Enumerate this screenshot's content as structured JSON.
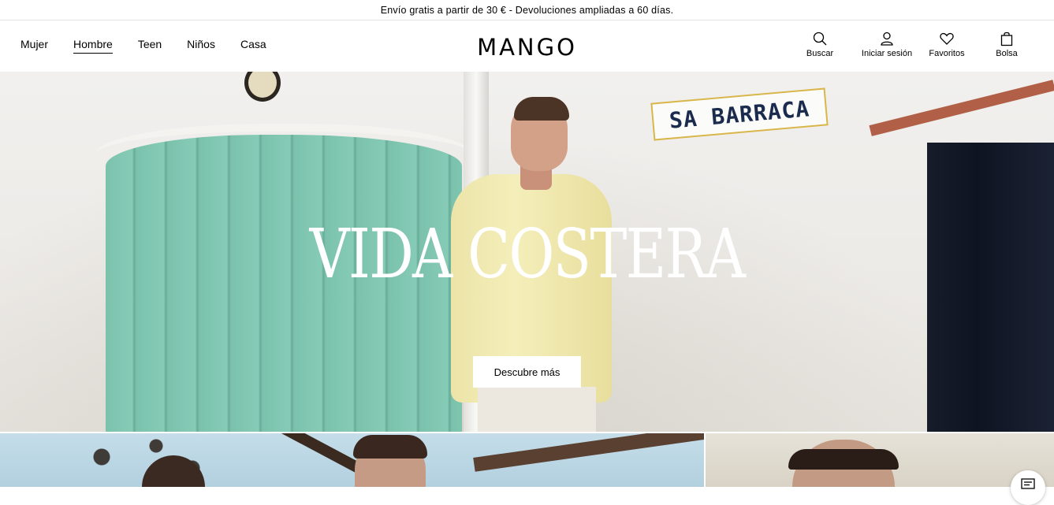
{
  "promo": {
    "text": "Envío gratis a partir de 30 € - Devoluciones ampliadas a 60 días."
  },
  "nav": {
    "items": [
      {
        "label": "Mujer"
      },
      {
        "label": "Hombre",
        "active": true
      },
      {
        "label": "Teen"
      },
      {
        "label": "Niños"
      },
      {
        "label": "Casa"
      }
    ]
  },
  "logo": {
    "text": "MANGO"
  },
  "actions": {
    "search": {
      "label": "Buscar",
      "icon": "search-icon"
    },
    "login": {
      "label": "Iniciar sesión",
      "icon": "user-icon"
    },
    "favorites": {
      "label": "Favoritos",
      "icon": "heart-icon"
    },
    "bag": {
      "label": "Bolsa",
      "icon": "bag-icon"
    }
  },
  "hero": {
    "title": "VIDA COSTERA",
    "cta": "Descubre más",
    "sign_text": "SA BARRACA"
  },
  "colors": {
    "accent": "#000000",
    "background": "#ffffff",
    "door_green": "#7bc2ad"
  }
}
